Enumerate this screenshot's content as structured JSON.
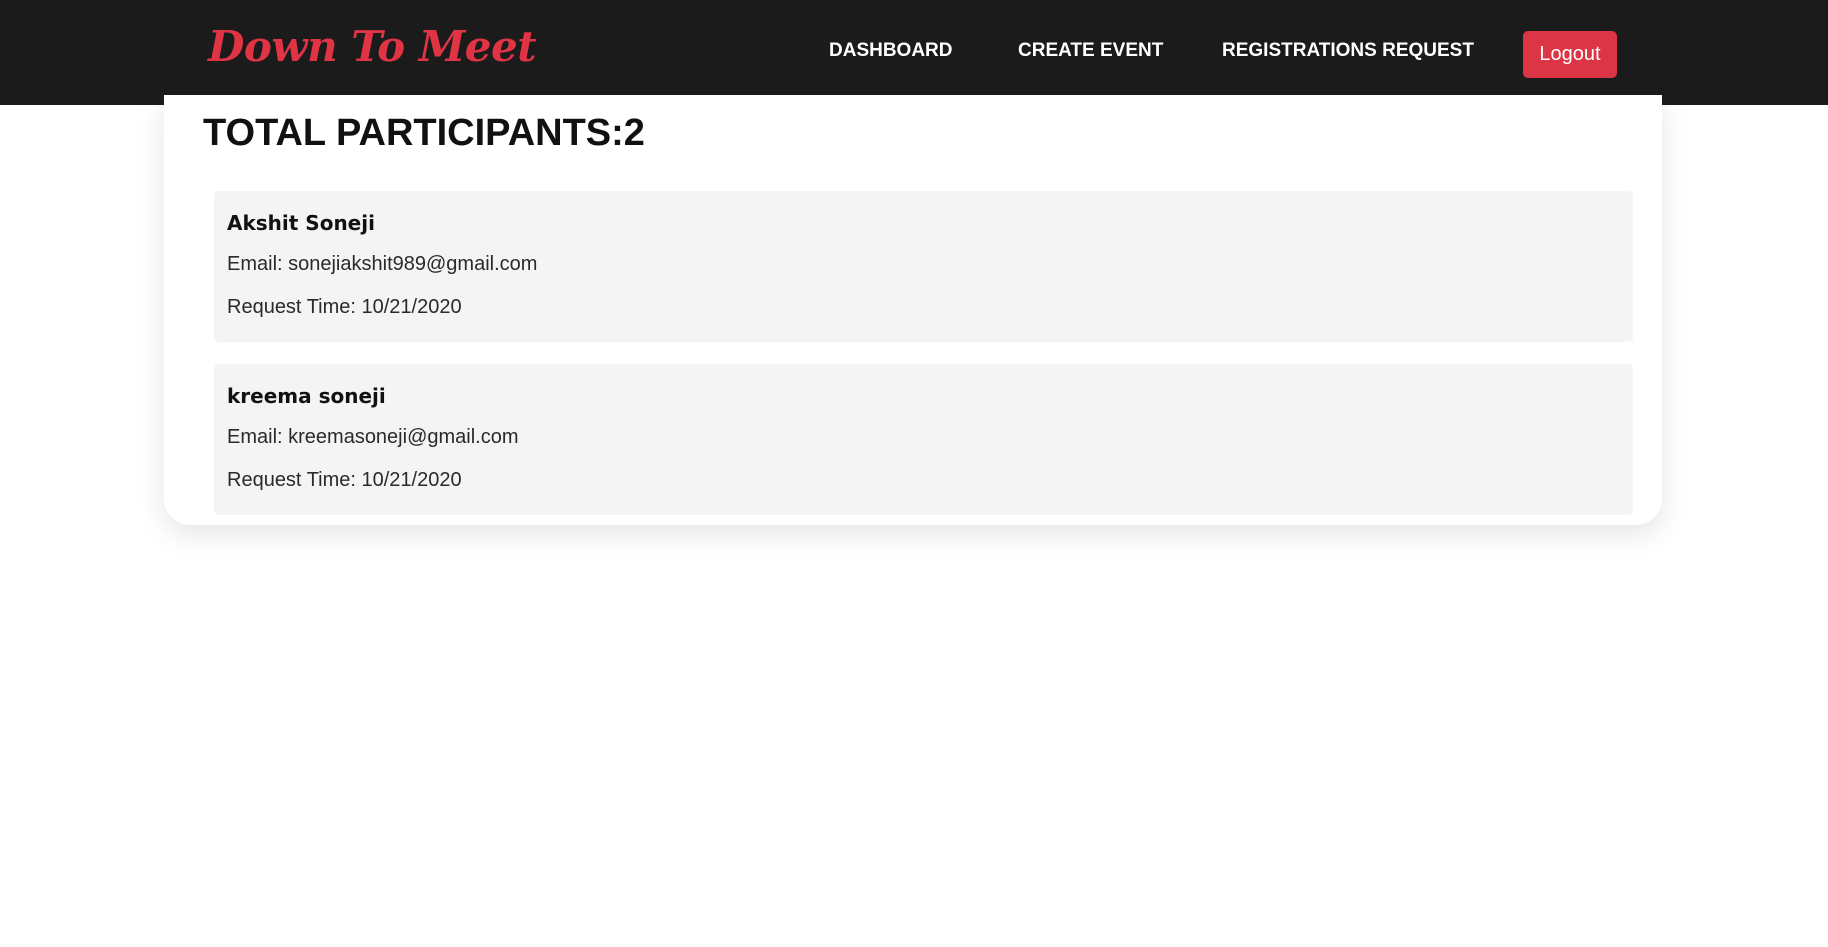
{
  "navbar": {
    "brand": "Down To Meet",
    "links": [
      {
        "label": "DASHBOARD"
      },
      {
        "label": "CREATE EVENT"
      },
      {
        "label": "REGISTRATIONS REQUEST"
      }
    ],
    "logout_label": "Logout",
    "colors": {
      "background": "#1b1b1b",
      "brand": "#e03445",
      "logout": "#dc3545"
    }
  },
  "main": {
    "title": "TOTAL PARTICIPANTS:2",
    "participants": [
      {
        "name": "Akshit Soneji",
        "email": "Email: sonejiakshit989@gmail.com",
        "request_time": "Request Time: 10/21/2020"
      },
      {
        "name": "kreema soneji",
        "email": "Email: kreemasoneji@gmail.com",
        "request_time": "Request Time: 10/21/2020"
      }
    ]
  }
}
